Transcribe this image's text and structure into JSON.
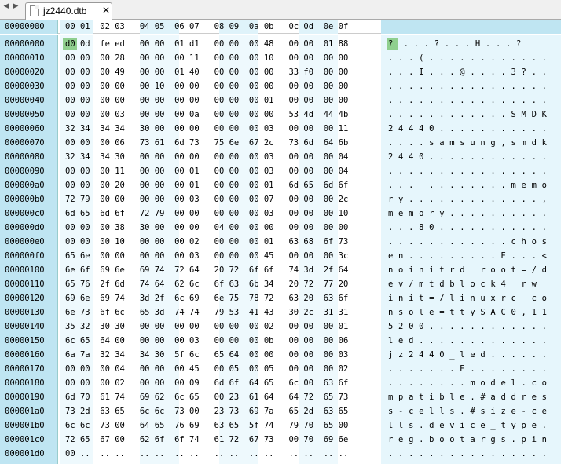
{
  "tab": {
    "title": "jz2440.dtb",
    "close": "✕"
  },
  "nav": {
    "back": "◀",
    "forward": "▶"
  },
  "header": {
    "offset": "00000000",
    "columns": "00 01  02 03   04 05  06 07   08 09  0a 0b   0c 0d  0e 0f"
  },
  "rows": [
    {
      "off": "00000000",
      "hex": "d0 0d  fe ed   00 00  01 d1   00 00  00 48   00 00  01 88",
      "asc": "?  . . . ? . . . H . . . ?"
    },
    {
      "off": "00000010",
      "hex": "00 00  00 28   00 00  00 11   00 00  00 10   00 00  00 00",
      "asc": ". . . ( . . . . . . . . . . . ."
    },
    {
      "off": "00000020",
      "hex": "00 00  00 49   00 00  01 40   00 00  00 00   33 f0  00 00",
      "asc": ". . . I . . . @ . . . . 3 ? . ."
    },
    {
      "off": "00000030",
      "hex": "00 00  00 00   00 10  00 00   00 00  00 00   00 00  00 00",
      "asc": ". . . . . . . . . . . . . . . ."
    },
    {
      "off": "00000040",
      "hex": "00 00  00 00   00 00  00 00   00 00  00 01   00 00  00 00",
      "asc": ". . . . . . . . . . . . . . . ."
    },
    {
      "off": "00000050",
      "hex": "00 00  00 03   00 00  00 0a   00 00  00 00   53 4d  44 4b",
      "asc": ". . . . . . . . . . . . S M D K"
    },
    {
      "off": "00000060",
      "hex": "32 34  34 34   30 00  00 00   00 00  00 03   00 00  00 11",
      "asc": "2 4 4 4 0 . . . . . . . . . . ."
    },
    {
      "off": "00000070",
      "hex": "00 00  00 06   73 61  6d 73   75 6e  67 2c   73 6d  64 6b",
      "asc": ". . . . s a m s u n g , s m d k"
    },
    {
      "off": "00000080",
      "hex": "32 34  34 30   00 00  00 00   00 00  00 03   00 00  00 04",
      "asc": "2 4 4 0 . . . . . . . . . . . ."
    },
    {
      "off": "00000090",
      "hex": "00 00  00 11   00 00  00 01   00 00  00 03   00 00  00 04",
      "asc": ". . . . . . . . . . . . . . . ."
    },
    {
      "off": "000000a0",
      "hex": "00 00  00 20   00 00  00 01   00 00  00 01   6d 65  6d 6f",
      "asc": ". . .   . . . . . . . . m e m o"
    },
    {
      "off": "000000b0",
      "hex": "72 79  00 00   00 00  00 03   00 00  00 07   00 00  00 2c",
      "asc": "r y . . . . . . . . . . . . . ,"
    },
    {
      "off": "000000c0",
      "hex": "6d 65  6d 6f   72 79  00 00   00 00  00 03   00 00  00 10",
      "asc": "m e m o r y . . . . . . . . . ."
    },
    {
      "off": "000000d0",
      "hex": "00 00  00 38   30 00  00 00   04 00  00 00   00 00  00 00",
      "asc": ". . . 8 0 . . . . . . . . . . ."
    },
    {
      "off": "000000e0",
      "hex": "00 00  00 10   00 00  00 02   00 00  00 01   63 68  6f 73",
      "asc": ". . . . . . . . . . . . c h o s"
    },
    {
      "off": "000000f0",
      "hex": "65 6e  00 00   00 00  00 03   00 00  00 45   00 00  00 3c",
      "asc": "e n . . . . . . . . . E . . . <"
    },
    {
      "off": "00000100",
      "hex": "6e 6f  69 6e   69 74  72 64   20 72  6f 6f   74 3d  2f 64",
      "asc": "n o i n i t r d   r o o t = / d"
    },
    {
      "off": "00000110",
      "hex": "65 76  2f 6d   74 64  62 6c   6f 63  6b 34   20 72  77 20",
      "asc": "e v / m t d b l o c k 4   r w  "
    },
    {
      "off": "00000120",
      "hex": "69 6e  69 74   3d 2f  6c 69   6e 75  78 72   63 20  63 6f",
      "asc": "i n i t = / l i n u x r c   c o"
    },
    {
      "off": "00000130",
      "hex": "6e 73  6f 6c   65 3d  74 74   79 53  41 43   30 2c  31 31",
      "asc": "n s o l e = t t y S A C 0 , 1 1"
    },
    {
      "off": "00000140",
      "hex": "35 32  30 30   00 00  00 00   00 00  00 02   00 00  00 01",
      "asc": "5 2 0 0 . . . . . . . . . . . ."
    },
    {
      "off": "00000150",
      "hex": "6c 65  64 00   00 00  00 03   00 00  00 0b   00 00  00 06",
      "asc": "l e d . . . . . . . . . . . . ."
    },
    {
      "off": "00000160",
      "hex": "6a 7a  32 34   34 30  5f 6c   65 64  00 00   00 00  00 03",
      "asc": "j z 2 4 4 0 _ l e d . . . . . ."
    },
    {
      "off": "00000170",
      "hex": "00 00  00 04   00 00  00 45   00 05  00 05   00 00  00 02",
      "asc": ". . . . . . . E . . . . . . . ."
    },
    {
      "off": "00000180",
      "hex": "00 00  00 02   00 00  00 09   6d 6f  64 65   6c 00  63 6f",
      "asc": ". . . . . . . . m o d e l . c o"
    },
    {
      "off": "00000190",
      "hex": "6d 70  61 74   69 62  6c 65   00 23  61 64   64 72  65 73",
      "asc": "m p a t i b l e . # a d d r e s"
    },
    {
      "off": "000001a0",
      "hex": "73 2d  63 65   6c 6c  73 00   23 73  69 7a   65 2d  63 65",
      "asc": "s - c e l l s . # s i z e - c e"
    },
    {
      "off": "000001b0",
      "hex": "6c 6c  73 00   64 65  76 69   63 65  5f 74   79 70  65 00",
      "asc": "l l s . d e v i c e _ t y p e ."
    },
    {
      "off": "000001c0",
      "hex": "72 65  67 00   62 6f  6f 74   61 72  67 73   00 70  69 6e",
      "asc": "r e g . b o o t a r g s . p i n"
    },
    {
      "off": "000001d0",
      "hex": "00 ..  .. ..   .. ..  .. ..   .. ..  .. ..   .. ..  .. ..",
      "asc": ". . . . . . . . . . . . . . . ."
    }
  ]
}
